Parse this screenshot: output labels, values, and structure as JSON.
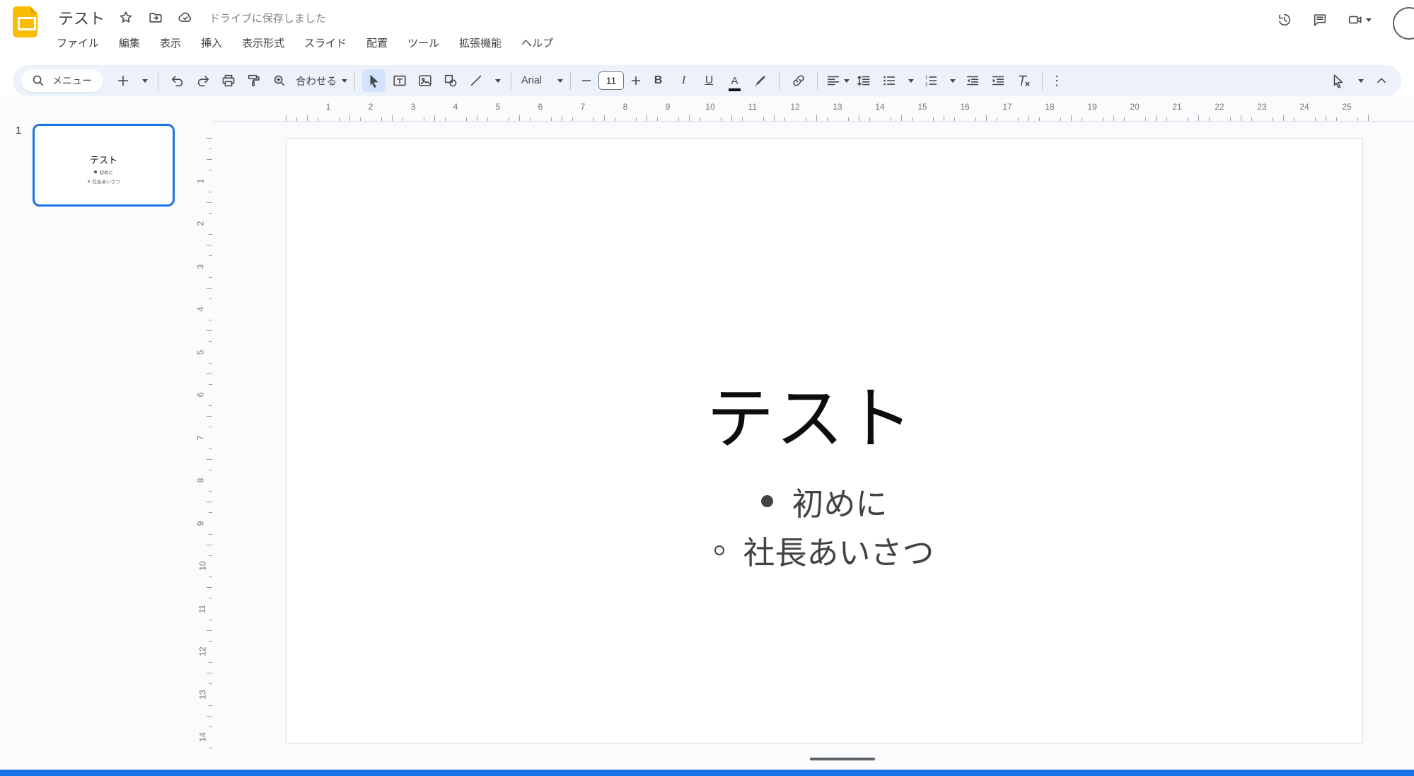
{
  "header": {
    "doc_title": "テスト",
    "saved_status": "ドライブに保存しました",
    "menus": [
      "ファイル",
      "編集",
      "表示",
      "挿入",
      "表示形式",
      "スライド",
      "配置",
      "ツール",
      "拡張機能",
      "ヘルプ"
    ]
  },
  "toolbar": {
    "search_label": "メニュー",
    "fit_label": "合わせる",
    "font_name": "Arial",
    "font_size": "11",
    "bold_label": "B",
    "italic_label": "I",
    "underline_label": "U",
    "text_color_label": "A",
    "more_label": "⋮"
  },
  "filmstrip": {
    "slide_number": "1",
    "thumbnail": {
      "title": "テスト",
      "bullet1": "初めに",
      "bullet2": "社長あいさつ"
    }
  },
  "rulers": {
    "horizontal": [
      "1",
      "2",
      "3",
      "4",
      "5",
      "6",
      "7",
      "8",
      "9",
      "10",
      "11",
      "12",
      "13",
      "14",
      "15",
      "16",
      "17",
      "18",
      "19",
      "20",
      "21",
      "22",
      "23",
      "24",
      "25"
    ],
    "vertical": [
      "1",
      "2",
      "3",
      "4",
      "5",
      "6",
      "7",
      "8",
      "9",
      "10",
      "11",
      "12",
      "13",
      "14"
    ]
  },
  "slide": {
    "title": "テスト",
    "bullet1": "初めに",
    "bullet2": "社長あいさつ"
  },
  "colors": {
    "toolbar_bg": "#edf2fa",
    "selected_tool_bg": "#d3e3fd",
    "accent_blue": "#1a73e8",
    "logo_yellow": "#fbbc04",
    "icon_gray": "#444746",
    "bottom_bar": "#1a73e8"
  }
}
